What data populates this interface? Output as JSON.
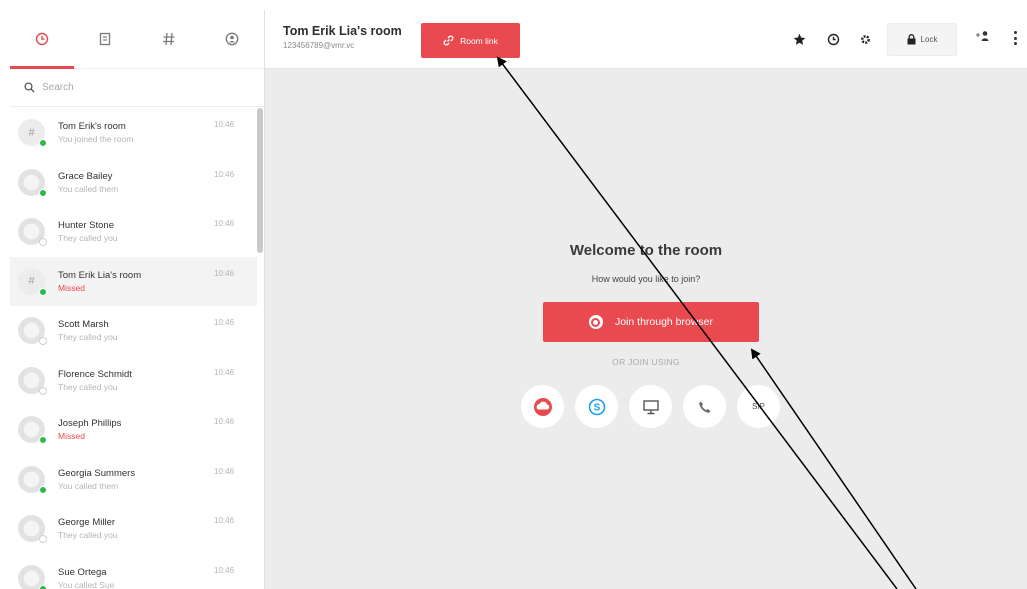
{
  "sidebar": {
    "tabs": [
      {
        "icon": "clock-icon",
        "active": true
      },
      {
        "icon": "contacts-icon",
        "active": false
      },
      {
        "icon": "hash-icon",
        "active": false
      },
      {
        "icon": "person-circle-icon",
        "active": false
      }
    ],
    "search_placeholder": "Search",
    "conversations": [
      {
        "avatar": "#",
        "name": "Tom Erik's room",
        "sub": "You joined the room",
        "time": "10:46",
        "status": "online",
        "missed": false,
        "highlight": false
      },
      {
        "avatar": "",
        "name": "Grace Bailey",
        "sub": "You called them",
        "time": "10:46",
        "status": "online",
        "missed": false,
        "highlight": false
      },
      {
        "avatar": "",
        "name": "Hunter Stone",
        "sub": "They called you",
        "time": "10:46",
        "status": "offline",
        "missed": false,
        "highlight": false
      },
      {
        "avatar": "#",
        "name": "Tom Erik Lia's room",
        "sub": "Missed",
        "time": "10:46",
        "status": "online",
        "missed": true,
        "highlight": true
      },
      {
        "avatar": "",
        "name": "Scott Marsh",
        "sub": "They called you",
        "time": "10:46",
        "status": "offline",
        "missed": false,
        "highlight": false
      },
      {
        "avatar": "",
        "name": "Florence Schmidt",
        "sub": "They called you",
        "time": "10:46",
        "status": "offline",
        "missed": false,
        "highlight": false
      },
      {
        "avatar": "",
        "name": "Joseph Phillips",
        "sub": "Missed",
        "time": "10:46",
        "status": "online",
        "missed": true,
        "highlight": false
      },
      {
        "avatar": "",
        "name": "Georgia Summers",
        "sub": "You called them",
        "time": "10:46",
        "status": "online",
        "missed": false,
        "highlight": false
      },
      {
        "avatar": "",
        "name": "George Miller",
        "sub": "They called you",
        "time": "10:46",
        "status": "offline",
        "missed": false,
        "highlight": false
      },
      {
        "avatar": "",
        "name": "Sue Ortega",
        "sub": "You called Sue",
        "time": "10:46",
        "status": "online",
        "missed": false,
        "highlight": false
      }
    ]
  },
  "header": {
    "room_title": "Tom Erik Lia's room",
    "room_id": "123456789@vmr.vc",
    "room_link_label": "Room link",
    "lock_label": "Lock"
  },
  "main": {
    "welcome_title": "Welcome to the room",
    "welcome_sub": "How would you like to join?",
    "join_button_label": "Join through browser",
    "or_join_label": "OR JOIN USING",
    "options": [
      {
        "icon": "app-icon"
      },
      {
        "icon": "skype-icon"
      },
      {
        "icon": "monitor-icon"
      },
      {
        "icon": "phone-icon"
      },
      {
        "icon": "sip-icon",
        "label": "SIP"
      }
    ]
  },
  "colors": {
    "accent": "#e84a4f",
    "online": "#2db84d",
    "background": "#ececec"
  }
}
